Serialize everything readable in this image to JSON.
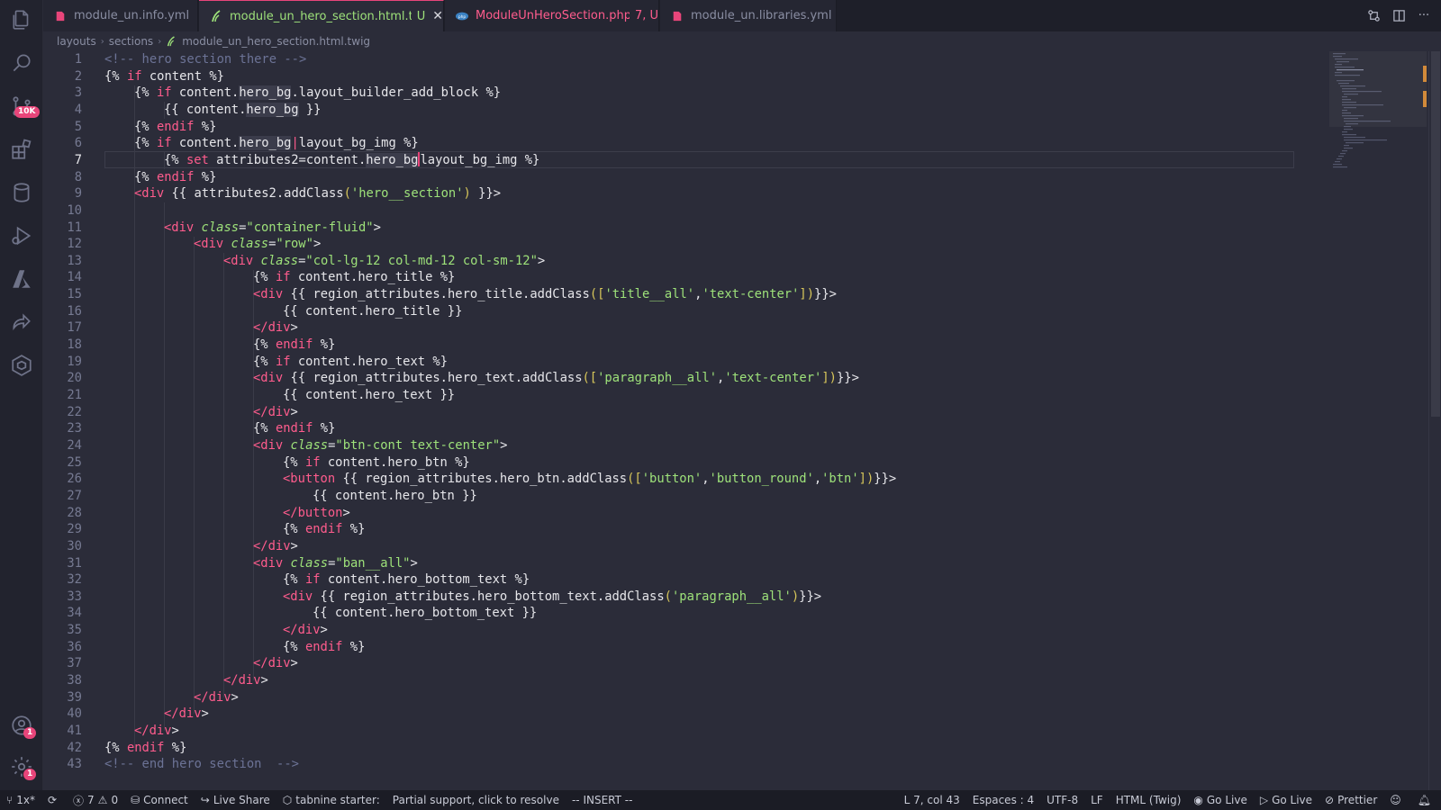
{
  "activity_bar": {
    "scm_badge": "10K",
    "accounts_badge": "1",
    "settings_badge": "1"
  },
  "tabs": [
    {
      "label": "module_un.info.yml",
      "status": "",
      "color": "#b8bbd0"
    },
    {
      "label": "module_un_hero_section.html.twig",
      "status": "U",
      "color": "#9ee27a",
      "active": true
    },
    {
      "label": "ModuleUnHeroSection.php",
      "status": "7, U",
      "color": "#ff5c8d"
    },
    {
      "label": "module_un.libraries.yml",
      "status": "",
      "color": "#b8bbd0"
    }
  ],
  "breadcrumb": {
    "items": [
      "layouts",
      "sections",
      "module_un_hero_section.html.twig"
    ]
  },
  "editor": {
    "line_numbers": [
      "1",
      "2",
      "3",
      "4",
      "5",
      "6",
      "7",
      "8",
      "9",
      "10",
      "11",
      "12",
      "13",
      "14",
      "15",
      "16",
      "17",
      "18",
      "19",
      "20",
      "21",
      "22",
      "23",
      "24",
      "25",
      "26",
      "27",
      "28",
      "29",
      "30",
      "31",
      "32",
      "33",
      "34",
      "35",
      "36",
      "37",
      "38",
      "39",
      "40",
      "41",
      "42",
      "43"
    ],
    "code": {
      "l1": "<!-- hero section there -->",
      "l2a": "{%",
      "l2b": "if",
      "l2c": " content ",
      "l2d": "%}",
      "l3a": "{%",
      "l3b": "if",
      "l3c": " content.",
      "l3d": "hero_bg",
      "l3e": ".layout_builder_add_block ",
      "l3f": "%}",
      "l4a": "{{",
      "l4b": " content.",
      "l4c": "hero_bg",
      "l4d": " }}",
      "l5a": "{%",
      "l5b": "endif",
      "l5c": " %}",
      "l6a": "{%",
      "l6b": "if",
      "l6c": " content.",
      "l6d": "hero_bg",
      "l6e": "|",
      "l6f": "layout_bg_img ",
      "l6g": "%}",
      "l7a": "{%",
      "l7b": "set",
      "l7c": " attributes2=content.",
      "l7d": "hero_bg",
      "l7e": "layout_bg_img ",
      "l7f": "%}",
      "l8a": "{%",
      "l8b": "endif",
      "l8c": " %}",
      "l9a": "<div",
      "l9b": " {{",
      "l9c": " attributes2.addClass",
      "l9d": "(",
      "l9e": "'hero__section'",
      "l9f": ")",
      "l9g": " }}",
      "l9h": ">",
      "l11a": "<div",
      "l11b": " class",
      "l11c": "=",
      "l11d": "\"container-fluid\"",
      "l11e": ">",
      "l12a": "<div",
      "l12b": " class",
      "l12c": "=",
      "l12d": "\"row\"",
      "l12e": ">",
      "l13a": "<div",
      "l13b": " class",
      "l13c": "=",
      "l13d": "\"col-lg-12 col-md-12 col-sm-12\"",
      "l13e": ">",
      "l14a": "{%",
      "l14b": "if",
      "l14c": " content.hero_title ",
      "l14d": "%}",
      "l15a": "<div",
      "l15b": " {{",
      "l15c": " region_attributes.hero_title.addClass",
      "l15d": "([",
      "l15e": "'title__all'",
      "l15f": ",",
      "l15g": "'text-center'",
      "l15h": "])",
      "l15i": "}}",
      "l15j": ">",
      "l16a": "{{",
      "l16b": " content.hero_title ",
      "l16c": "}}",
      "l17a": "</div",
      "l17b": ">",
      "l18a": "{%",
      "l18b": "endif",
      "l18c": " %}",
      "l19a": "{%",
      "l19b": "if",
      "l19c": " content.hero_text ",
      "l19d": "%}",
      "l20a": "<div",
      "l20b": " {{",
      "l20c": " region_attributes.hero_text.addClass",
      "l20d": "([",
      "l20e": "'paragraph__all'",
      "l20f": ",",
      "l20g": "'text-center'",
      "l20h": "])",
      "l20i": "}}",
      "l20j": ">",
      "l21a": "{{",
      "l21b": " content.hero_text ",
      "l21c": "}}",
      "l22a": "</div",
      "l22b": ">",
      "l23a": "{%",
      "l23b": "endif",
      "l23c": " %}",
      "l24a": "<div",
      "l24b": " class",
      "l24c": "=",
      "l24d": "\"btn-cont text-center\"",
      "l24e": ">",
      "l25a": "{%",
      "l25b": "if",
      "l25c": " content.hero_btn ",
      "l25d": "%}",
      "l26a": "<button",
      "l26b": " {{",
      "l26c": " region_attributes.hero_btn.addClass",
      "l26d": "([",
      "l26e": "'button'",
      "l26f": ",",
      "l26g": "'button_round'",
      "l26h": ",",
      "l26i": "'btn'",
      "l26j": "])",
      "l26k": "}}",
      "l26l": ">",
      "l27a": "{{",
      "l27b": " content.hero_btn ",
      "l27c": "}}",
      "l28a": "</button",
      "l28b": ">",
      "l29a": "{%",
      "l29b": "endif",
      "l29c": " %}",
      "l30a": "</div",
      "l30b": ">",
      "l31a": "<div",
      "l31b": " class",
      "l31c": "=",
      "l31d": "\"ban__all\"",
      "l31e": ">",
      "l32a": "{%",
      "l32b": "if",
      "l32c": " content.hero_bottom_text ",
      "l32d": "%}",
      "l33a": "<div",
      "l33b": " {{",
      "l33c": " region_attributes.hero_bottom_text.addClass",
      "l33d": "(",
      "l33e": "'paragraph__all'",
      "l33f": ")",
      "l33g": "}}",
      "l33h": ">",
      "l34a": "{{",
      "l34b": " content.hero_bottom_text ",
      "l34c": "}}",
      "l35a": "</div",
      "l35b": ">",
      "l36a": "{%",
      "l36b": "endif",
      "l36c": " %}",
      "l37a": "</div",
      "l37b": ">",
      "l38a": "</div",
      "l38b": ">",
      "l39a": "</div",
      "l39b": ">",
      "l40a": "</div",
      "l40b": ">",
      "l41a": "</div",
      "l41b": ">",
      "l42a": "{%",
      "l42b": "endif",
      "l42c": " %}",
      "l43": "<!-- end hero section  -->"
    }
  },
  "status_bar": {
    "branch": "1x*",
    "errors": "7",
    "warnings": "0",
    "connect": "Connect",
    "live_share": "Live Share",
    "tabnine": "tabnine starter:",
    "partial_support": "Partial support, click to resolve",
    "mode": "-- INSERT --",
    "cursor_pos": "L 7, col 43",
    "spaces": "Espaces : 4",
    "encoding": "UTF-8",
    "eol": "LF",
    "language": "HTML (Twig)",
    "go_live_1": "Go Live",
    "go_live_2": "Go Live",
    "prettier": "Prettier"
  },
  "colors": {
    "accent": "#e8457a",
    "editor_bg": "#2b2c39",
    "keyword": "#ff5c8d",
    "string": "#9ee27a",
    "bracket": "#d7c65a",
    "comment": "#6c7396"
  }
}
